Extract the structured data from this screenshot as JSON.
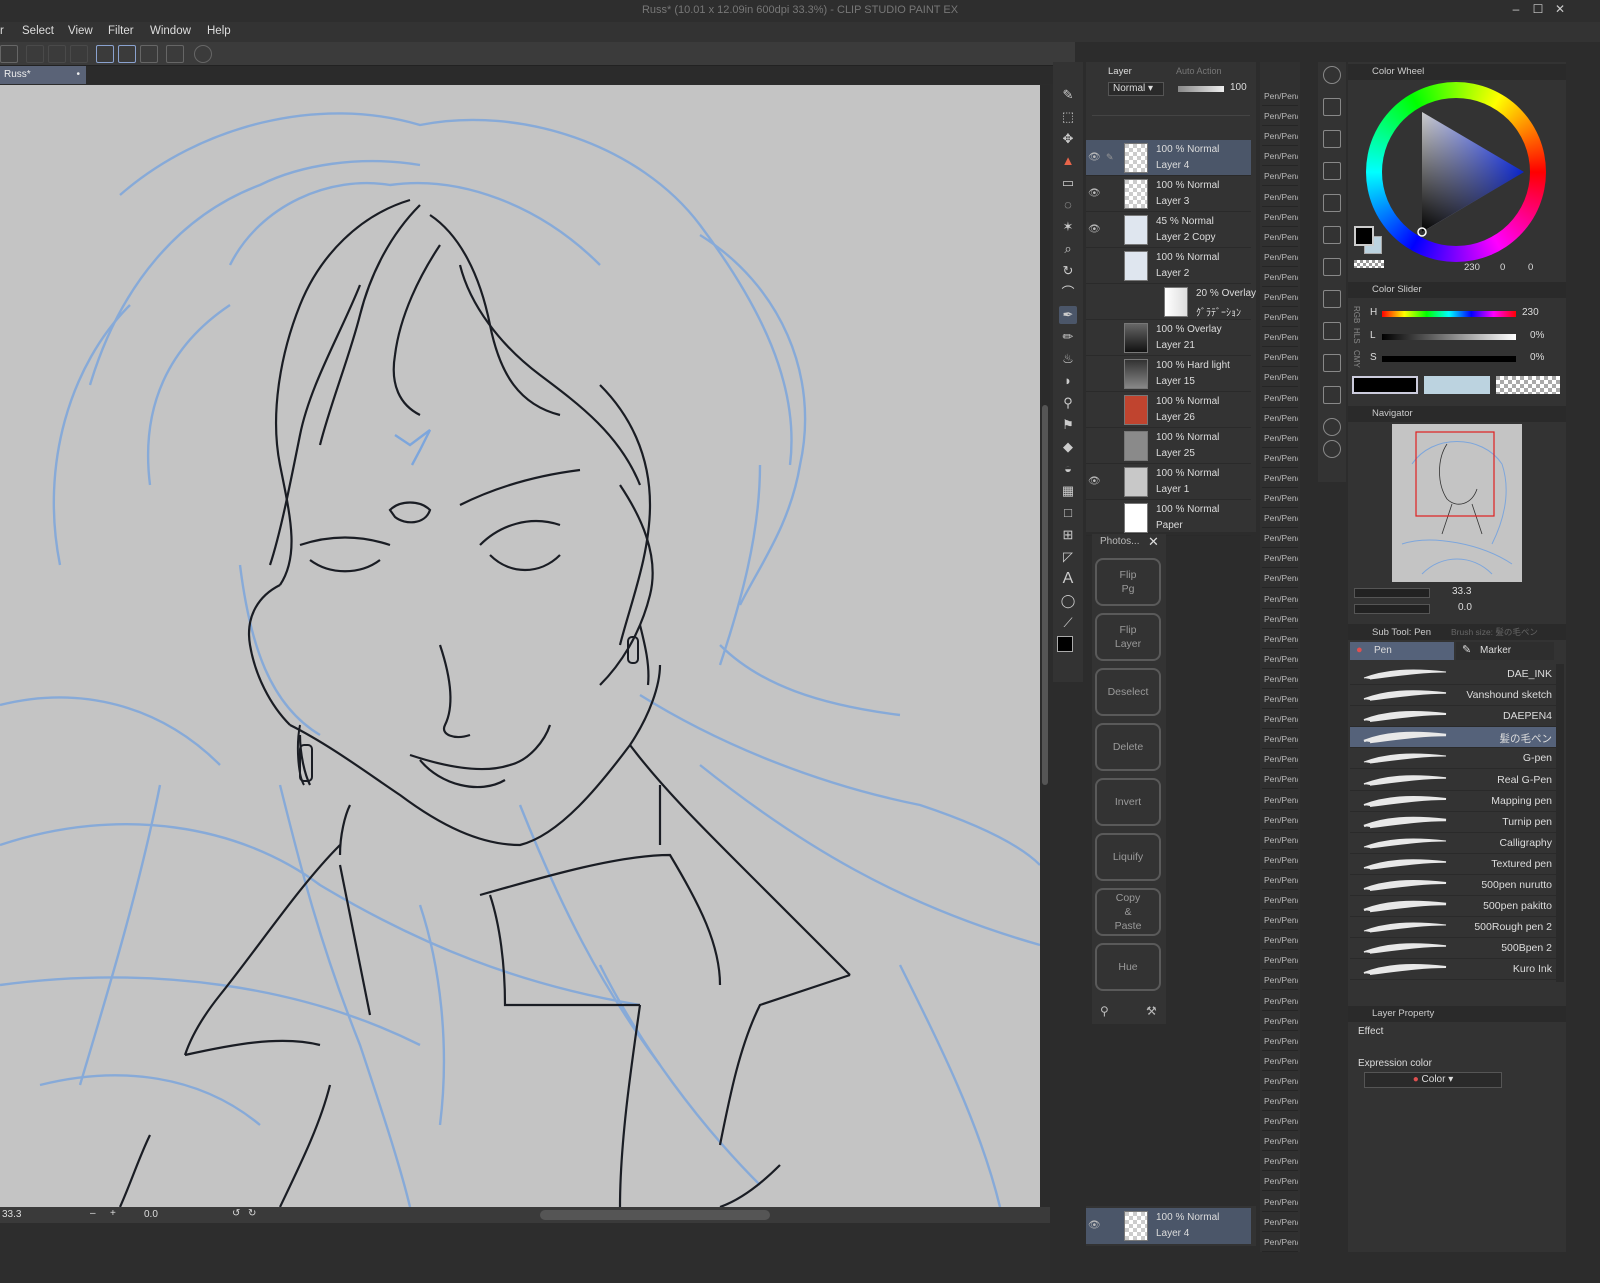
{
  "window": {
    "title": "Russ* (10.01 x 12.09in 600dpi 33.3%) - CLIP STUDIO PAINT EX"
  },
  "menu": [
    "r",
    "Select",
    "View",
    "Filter",
    "Window",
    "Help"
  ],
  "doc_tab": "Russ*",
  "status": {
    "zoom": "33.3",
    "angle": "0.0"
  },
  "layer_panel": {
    "title": "Layer",
    "tab2": "Auto Action",
    "blend_mode": "Normal",
    "opacity": "100",
    "layers": [
      {
        "top": "100 % Normal",
        "name": "Layer 4",
        "visible": true,
        "selected": true,
        "thumb": "checker"
      },
      {
        "top": "100 % Normal",
        "name": "Layer 3",
        "visible": true,
        "thumb": "checker"
      },
      {
        "top": "45 % Normal",
        "name": "Layer 2 Copy",
        "visible": true,
        "thumb": "sketch"
      },
      {
        "top": "100 % Normal",
        "name": "Layer 2",
        "visible": false,
        "thumb": "sketch"
      },
      {
        "top": "20 % Overlay",
        "name": "ｸﾞﾗﾃﾞｰｼｮﾝ",
        "visible": false,
        "thumb": "grad"
      },
      {
        "top": "100 % Overlay",
        "name": "Layer 21",
        "visible": false,
        "thumb": "dark"
      },
      {
        "top": "100 % Hard light",
        "name": "Layer 15",
        "visible": false,
        "thumb": "darkgrad"
      },
      {
        "top": "100 % Normal",
        "name": "Layer 26",
        "visible": false,
        "thumb": "red"
      },
      {
        "top": "100 % Normal",
        "name": "Layer 25",
        "visible": false,
        "thumb": "gray"
      },
      {
        "top": "100 % Normal",
        "name": "Layer 1",
        "visible": true,
        "thumb": "lightgray"
      },
      {
        "top": "100 % Normal",
        "name": "Paper",
        "visible": false,
        "thumb": "white"
      }
    ],
    "bottom_layer": {
      "top": "100 % Normal",
      "name": "Layer 4"
    }
  },
  "photos_panel": {
    "title": "Photos...",
    "buttons": [
      "Flip\nPg",
      "Flip\nLayer",
      "Deselect",
      "Delete",
      "Invert",
      "Liquify",
      "Copy\n&\nPaste",
      "Hue"
    ]
  },
  "pen_column_label": "Pen/Pen/",
  "color_wheel": {
    "title": "Color Wheel",
    "readout": "230",
    "s": "0",
    "v": "0"
  },
  "color_slider": {
    "title": "Color Slider",
    "rows": [
      {
        "label": "H",
        "value": "230"
      },
      {
        "label": "L",
        "value": "0%"
      },
      {
        "label": "S",
        "value": "0%"
      }
    ],
    "side_labels": [
      "RGB",
      "HLS",
      "CMY"
    ]
  },
  "navigator": {
    "title": "Navigator",
    "zoom": "33.3",
    "angle": "0.0"
  },
  "subtool": {
    "title": "Sub Tool: Pen",
    "tab2": "Brush size: 髪の毛ペン",
    "groups": [
      "Pen",
      "Marker"
    ],
    "brushes": [
      "DAE_INK",
      "Vanshound sketch",
      "DAEPEN4",
      "髪の毛ペン",
      "G-pen",
      "Real G-Pen",
      "Mapping pen",
      "Turnip pen",
      "Calligraphy",
      "Textured pen",
      "500pen nurutto",
      "500pen pakitto",
      "500Rough pen 2",
      "500Bpen 2",
      "Kuro Ink"
    ],
    "selected_index": 3
  },
  "layer_property": {
    "title": "Layer Property",
    "effect_label": "Effect",
    "expression_label": "Expression color",
    "expression_value": "Color"
  },
  "colors": {
    "main": "#000000",
    "sub": "#bcd3e0",
    "accent": "#4b5669",
    "canvas": "#c4c4c4",
    "sketch": "#7da6dc"
  }
}
